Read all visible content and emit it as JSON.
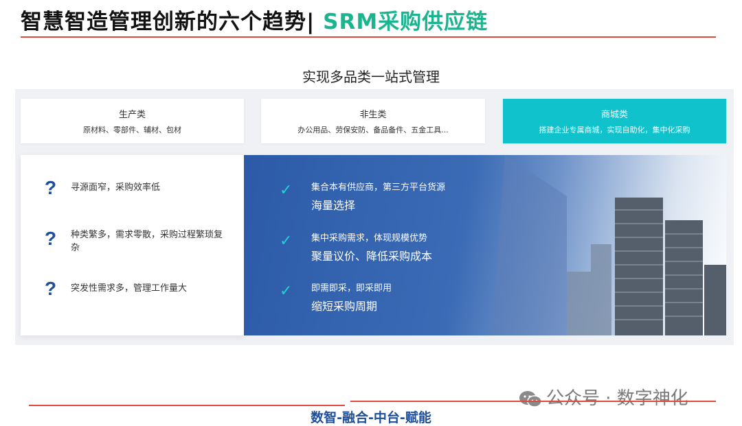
{
  "header": {
    "title_main": "智慧智造管理创新的六个趋势",
    "separator": "|",
    "title_accent": "SRM采购供应链"
  },
  "subtitle": "实现多品类一站式管理",
  "categories": [
    {
      "name": "生产类",
      "desc": "原材料、零部件、辅材、包材"
    },
    {
      "name": "非生类",
      "desc": "办公用品、劳保安防、备品备件、五金工具..."
    },
    {
      "name": "商城类",
      "desc": "搭建企业专属商城，实现自助化，集中化采购"
    }
  ],
  "pain_points": [
    {
      "icon": "question-mark-icon",
      "text": "寻源面窄，采购效率低"
    },
    {
      "icon": "question-mark-icon",
      "text": "种类繁多，需求零散，采购过程繁琐复杂"
    },
    {
      "icon": "question-mark-icon",
      "text": "突发性需求多，管理工作量大"
    }
  ],
  "benefits": [
    {
      "icon": "check-icon",
      "small": "集合本有供应商，第三方平台货源",
      "big": "海量选择"
    },
    {
      "icon": "check-icon",
      "small": "集中采购需求，体现规模优势",
      "big": "聚量议价、降低采购成本"
    },
    {
      "icon": "check-icon",
      "small": "即需即采，即采即用",
      "big": "缩短采购周期"
    }
  ],
  "watermark": "公众号 · 数字神化",
  "footer": "数智-融合-中台-赋能",
  "colors": {
    "accent_green": "#1cb38f",
    "rule_red": "#e2473b",
    "active_cyan": "#0fc2cc",
    "brand_blue": "#1e4f9c"
  }
}
